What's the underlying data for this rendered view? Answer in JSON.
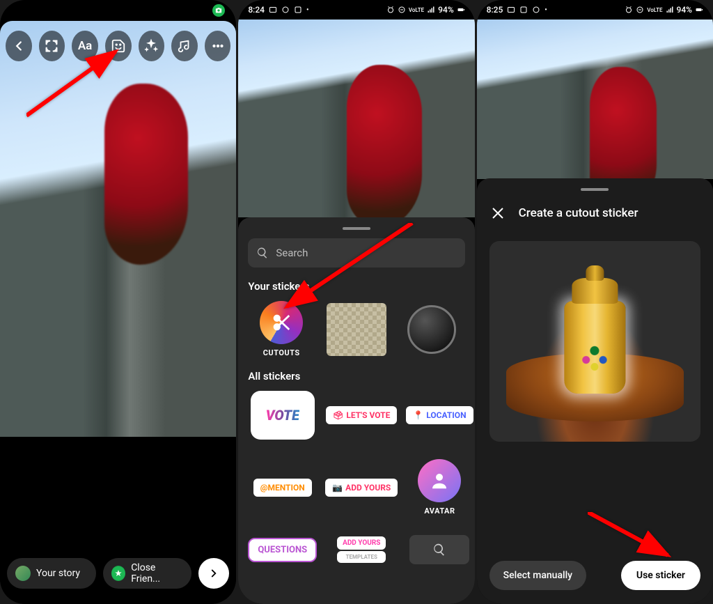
{
  "status": {
    "time1": "8:24",
    "time2": "8:25",
    "battery": "94%",
    "net": "VoLTE"
  },
  "screen1": {
    "your_story": "Your story",
    "close_friends": "Close Frien..."
  },
  "screen2": {
    "search_placeholder": "Search",
    "your_stickers": "Your stickers",
    "cutouts": "CUTOUTS",
    "all_stickers": "All stickers",
    "vote": "VOTE",
    "lets_vote": "LET'S VOTE",
    "location": "LOCATION",
    "mention": "@MENTION",
    "add_yours": "ADD YOURS",
    "avatar": "AVATAR",
    "questions": "QUESTIONS",
    "add_yours2": "ADD YOURS",
    "templates": "TEMPLATES"
  },
  "screen3": {
    "title": "Create a cutout sticker",
    "select_manually": "Select manually",
    "use_sticker": "Use sticker"
  }
}
